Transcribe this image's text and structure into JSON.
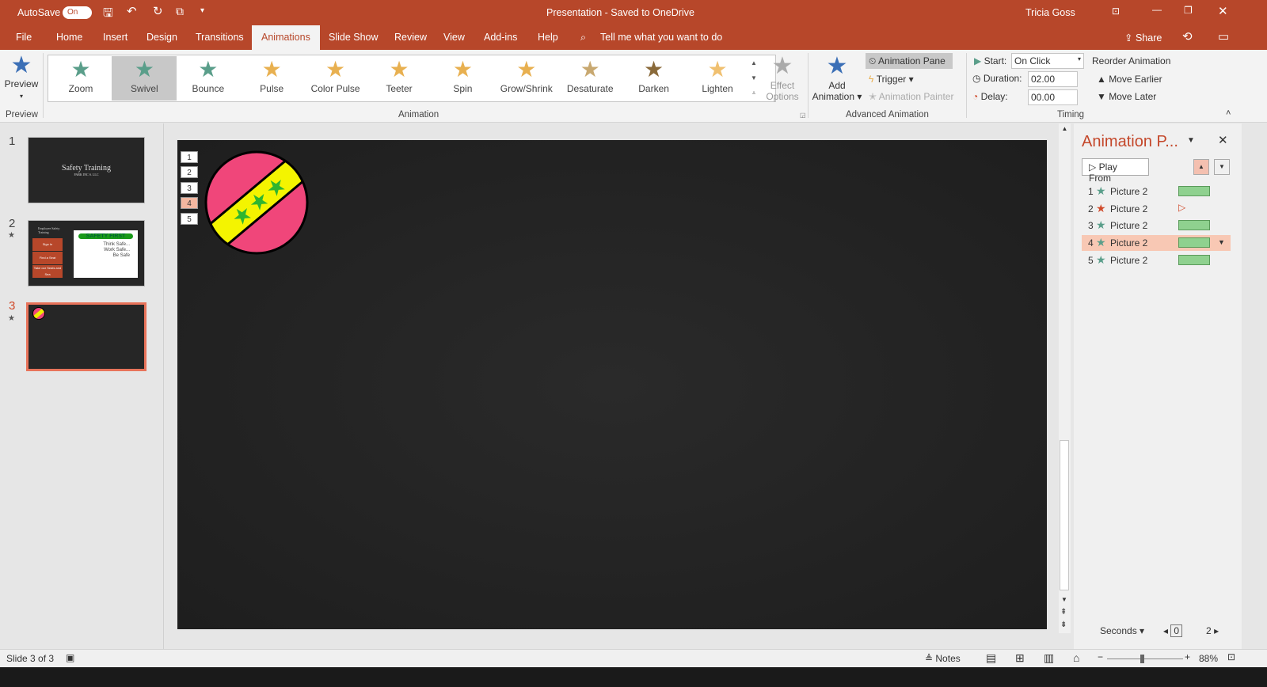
{
  "titlebar": {
    "autosave": "AutoSave",
    "toggle": "On",
    "title": "Presentation  -  Saved to OneDrive",
    "user": "Tricia Goss"
  },
  "tabs": [
    "File",
    "Home",
    "Insert",
    "Design",
    "Transitions",
    "Animations",
    "Slide Show",
    "Review",
    "View",
    "Add-ins",
    "Help"
  ],
  "tell_me": "Tell me what you want to do",
  "share": "Share",
  "ribbon": {
    "preview": "Preview",
    "preview_group": "Preview",
    "animations": [
      {
        "label": "Zoom",
        "color": "#5a9e8a"
      },
      {
        "label": "Swivel",
        "color": "#5a9e8a"
      },
      {
        "label": "Bounce",
        "color": "#5a9e8a"
      },
      {
        "label": "Pulse",
        "color": "#e8b050"
      },
      {
        "label": "Color Pulse",
        "color": "#e8b050"
      },
      {
        "label": "Teeter",
        "color": "#e8b050"
      },
      {
        "label": "Spin",
        "color": "#e8b050"
      },
      {
        "label": "Grow/Shrink",
        "color": "#e8b050"
      },
      {
        "label": "Desaturate",
        "color": "#c8a870"
      },
      {
        "label": "Darken",
        "color": "#8a6a3a"
      },
      {
        "label": "Lighten",
        "color": "#f0c070"
      }
    ],
    "selected_animation": "Swivel",
    "effect_options": [
      "Effect",
      "Options"
    ],
    "animation_group": "Animation",
    "add_animation": [
      "Add",
      "Animation"
    ],
    "animation_pane": "Animation Pane",
    "trigger": "Trigger",
    "animation_painter": "Animation Painter",
    "advanced_group": "Advanced Animation",
    "start_label": "Start:",
    "start_value": "On Click",
    "duration_label": "Duration:",
    "duration_value": "02.00",
    "delay_label": "Delay:",
    "delay_value": "00.00",
    "reorder": "Reorder Animation",
    "move_earlier": "Move Earlier",
    "move_later": "Move Later",
    "timing_group": "Timing"
  },
  "slides": [
    {
      "num": "1",
      "title": "Safety Training",
      "subtitle": "PARK INC S. LLC"
    },
    {
      "num": "2",
      "heading": "Employee Safety Training",
      "boxes": [
        "Sign In",
        "Find a Seat",
        "Take our Seats and Sea"
      ],
      "badge": "SAFETY FIRST",
      "lines": [
        "Think Safe...",
        "Work Safe...",
        "Be Safe"
      ]
    },
    {
      "num": "3"
    }
  ],
  "current_slide": 3,
  "anim_tags": [
    "1",
    "2",
    "3",
    "4",
    "5"
  ],
  "anim_pane": {
    "title": "Animation P...",
    "play_from": "Play From",
    "items": [
      {
        "num": "1",
        "name": "Picture 2",
        "type": "emphasis"
      },
      {
        "num": "2",
        "name": "Picture 2",
        "type": "exit"
      },
      {
        "num": "3",
        "name": "Picture 2",
        "type": "emphasis"
      },
      {
        "num": "4",
        "name": "Picture 2",
        "type": "emphasis",
        "selected": true
      },
      {
        "num": "5",
        "name": "Picture 2",
        "type": "emphasis"
      }
    ],
    "seconds": "Seconds",
    "timeline_start": "0",
    "timeline_end": "2"
  },
  "status": {
    "slide": "Slide 3 of 3",
    "notes": "Notes",
    "zoom": "88%",
    "zoom_percent": 88
  }
}
